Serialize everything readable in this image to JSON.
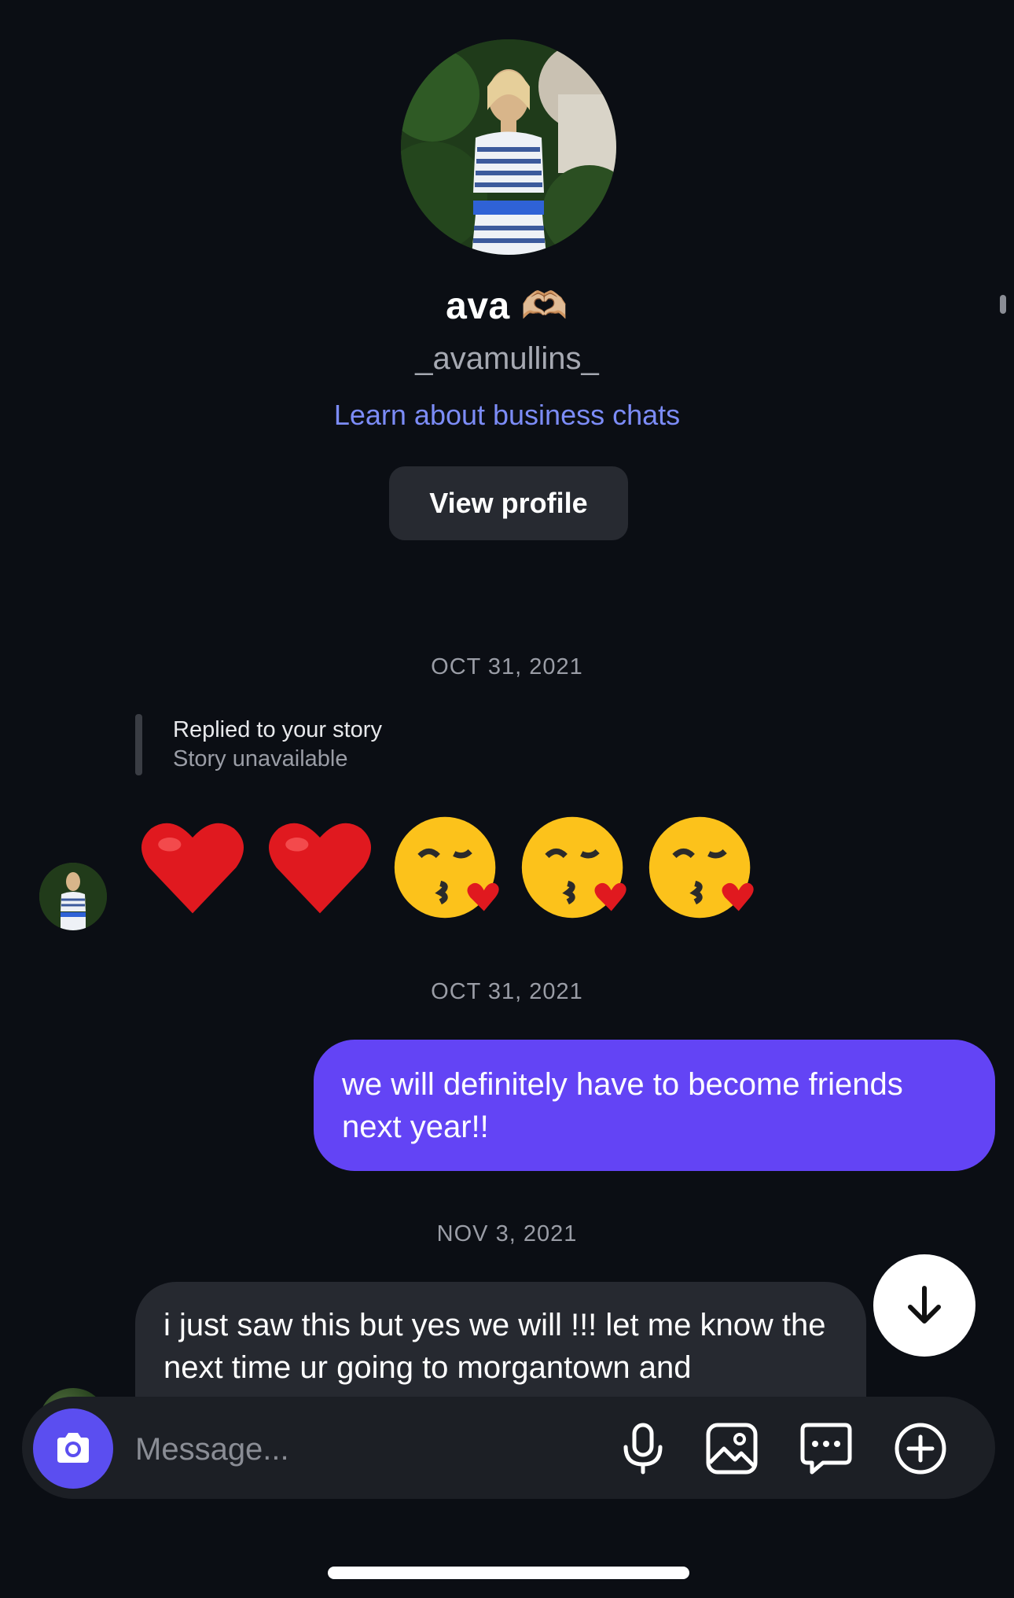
{
  "profile": {
    "name": "ava 🫶🏼",
    "handle": "_avamullins_",
    "business_link": "Learn about business chats",
    "view_profile_label": "View profile"
  },
  "messages": {
    "date_1": "OCT 31, 2021",
    "reply_title": "Replied to your story",
    "reply_sub": "Story unavailable",
    "emojis": [
      "❤️",
      "❤️",
      "😘",
      "😘",
      "😘"
    ],
    "date_2": "OCT 31, 2021",
    "sent_1": "we will definitely have to become friends next year!!",
    "date_3": "NOV 3, 2021",
    "received_2": "i just saw this but yes we will !!! let me know the next time ur going to morgantown and"
  },
  "composer": {
    "placeholder": "Message..."
  },
  "colors": {
    "background": "#0b0e14",
    "sent_bubble": "#6344f5",
    "received_bubble": "#262930",
    "link": "#7c8cf7",
    "camera_button": "#5b4ef0"
  },
  "icons": [
    "camera-icon",
    "microphone-icon",
    "gallery-icon",
    "sticker-chat-icon",
    "plus-circle-icon",
    "arrow-down-icon"
  ]
}
